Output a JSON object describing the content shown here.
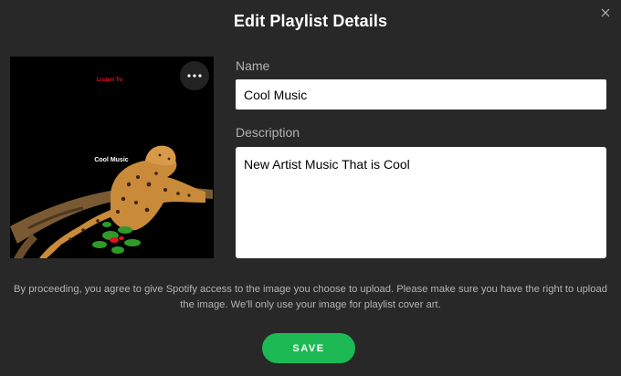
{
  "dialog": {
    "title": "Edit Playlist Details",
    "close_icon": "close-icon"
  },
  "cover": {
    "top_text": "Listen To",
    "center_text": "Cool Music",
    "more_icon": "more-horizontal-icon",
    "accent_text_color": "#e0141e"
  },
  "form": {
    "name_label": "Name",
    "name_value": "Cool Music",
    "description_label": "Description",
    "description_value": "New Artist Music That is Cool"
  },
  "disclaimer": "By proceeding, you agree to give Spotify access to the image you choose to upload. Please make sure you have the right to upload the image. We'll only use your image for playlist cover art.",
  "save_label": "SAVE",
  "colors": {
    "background": "#282828",
    "accent": "#1db954",
    "muted_text": "#b3b3b3"
  }
}
